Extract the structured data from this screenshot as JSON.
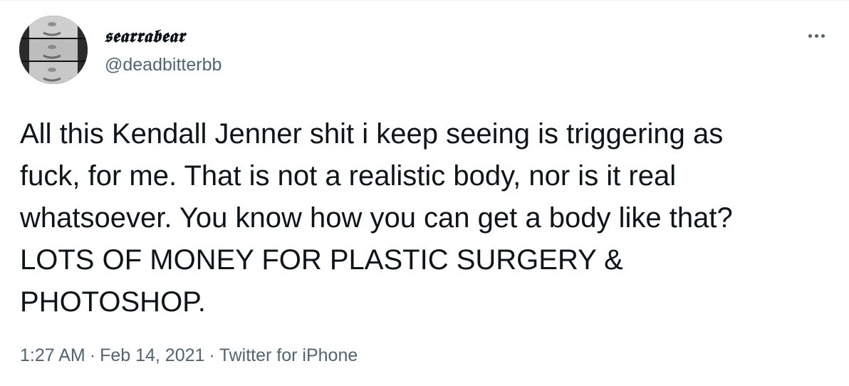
{
  "author": {
    "display_name": "𝖘𝖊𝖆𝖗𝖗𝖆𝖇𝖊𝖆𝖗",
    "handle": "@deadbitterbb",
    "avatar_icon": "avatar-collage-icon"
  },
  "menu": {
    "more_icon": "more-horizontal-icon"
  },
  "tweet": {
    "text": "All this Kendall Jenner shit i keep seeing is triggering as\nfuck, for me. That is not a realistic body, nor is it real\nwhatsoever. You know how you can get a body like that?\nLOTS OF MONEY FOR PLASTIC SURGERY &\nPHOTOSHOP."
  },
  "meta": {
    "time": "1:27 AM",
    "separator": "·",
    "date": "Feb 14, 2021",
    "source": "Twitter for iPhone"
  },
  "colors": {
    "text_primary": "#0f1419",
    "text_secondary": "#536471",
    "background": "#ffffff"
  }
}
